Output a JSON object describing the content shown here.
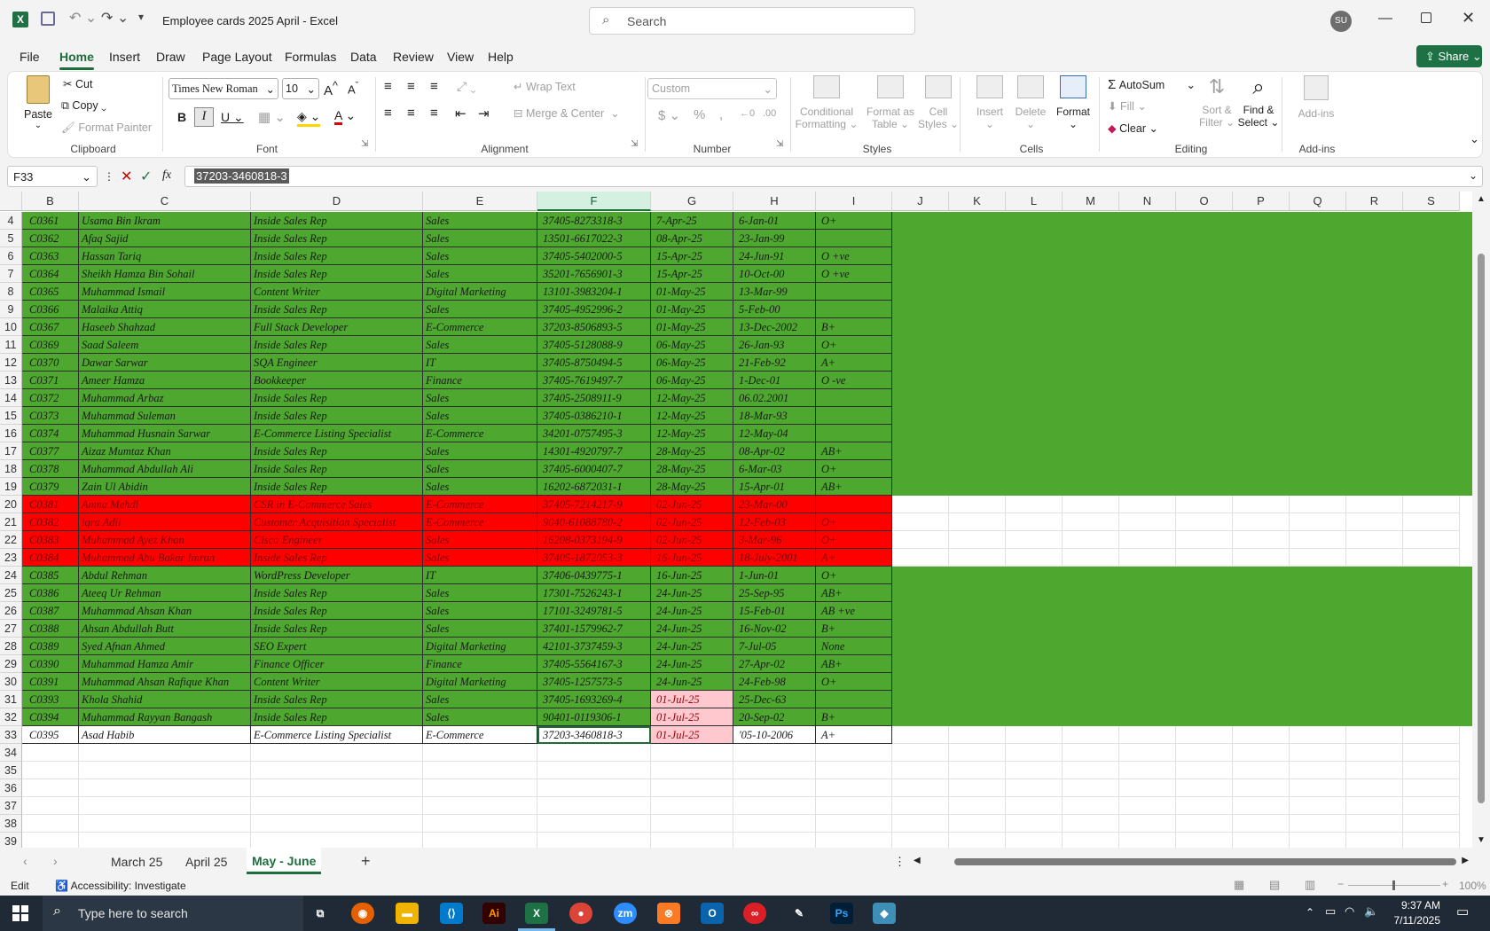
{
  "window": {
    "title": "Employee cards 2025 April  -  Excel",
    "search_placeholder": "Search",
    "user_initials": "SU"
  },
  "menu": {
    "tabs": [
      "File",
      "Home",
      "Insert",
      "Draw",
      "Page Layout",
      "Formulas",
      "Data",
      "Review",
      "View",
      "Help"
    ],
    "share": "Share"
  },
  "ribbon": {
    "clipboard": {
      "label": "Clipboard",
      "paste": "Paste",
      "cut": "Cut",
      "copy": "Copy",
      "format_painter": "Format Painter"
    },
    "font": {
      "label": "Font",
      "family": "Times New Roman",
      "size": "10"
    },
    "alignment": {
      "label": "Alignment",
      "wrap": "Wrap Text",
      "merge": "Merge & Center"
    },
    "number": {
      "label": "Number",
      "format": "Custom"
    },
    "styles": {
      "label": "Styles",
      "conditional": "Conditional",
      "conditional2": "Formatting",
      "format_table": "Format as",
      "format_table2": "Table",
      "cell_styles": "Cell",
      "cell_styles2": "Styles"
    },
    "cells": {
      "label": "Cells",
      "insert": "Insert",
      "delete": "Delete",
      "format": "Format"
    },
    "editing": {
      "label": "Editing",
      "autosum": "AutoSum",
      "fill": "Fill",
      "clear": "Clear",
      "sort": "Sort &",
      "sort2": "Filter",
      "find": "Find &",
      "find2": "Select"
    },
    "addins": {
      "label": "Add-ins",
      "addins": "Add-ins"
    }
  },
  "formula_bar": {
    "name_box": "F33",
    "value": "37203-3460818-3"
  },
  "columns": [
    "B",
    "C",
    "D",
    "E",
    "F",
    "G",
    "H",
    "I",
    "J",
    "K",
    "L",
    "M",
    "N",
    "O",
    "P",
    "Q",
    "R",
    "S"
  ],
  "selected_column": "F",
  "rows": [
    {
      "n": "4",
      "fill": "green",
      "cells": [
        "C0361",
        "Usama Bin Ikram",
        "Inside Sales Rep",
        "Sales",
        "37405-8273318-3",
        "7-Apr-25",
        "6-Jan-01",
        "O+"
      ]
    },
    {
      "n": "5",
      "fill": "green",
      "cells": [
        "C0362",
        "Afaq Sajid",
        "Inside Sales Rep",
        "Sales",
        "13501-6617022-3",
        "08-Apr-25",
        "23-Jan-99",
        ""
      ]
    },
    {
      "n": "6",
      "fill": "green",
      "cells": [
        "C0363",
        "Hassan Tariq",
        "Inside Sales Rep",
        "Sales",
        "37405-5402000-5",
        "15-Apr-25",
        "24-Jun-91",
        "O +ve"
      ]
    },
    {
      "n": "7",
      "fill": "green",
      "cells": [
        "C0364",
        "Sheikh Hamza Bin Sohail",
        "Inside Sales Rep",
        "Sales",
        "35201-7656901-3",
        "15-Apr-25",
        "10-Oct-00",
        "O +ve"
      ]
    },
    {
      "n": "8",
      "fill": "green",
      "cells": [
        "C0365",
        "Muhammad Ismail",
        "Content Writer",
        "Digital Marketing",
        "13101-3983204-1",
        "01-May-25",
        "13-Mar-99",
        ""
      ]
    },
    {
      "n": "9",
      "fill": "green",
      "cells": [
        "C0366",
        "Malaika Attiq",
        "Inside Sales Rep",
        "Sales",
        "37405-4952996-2",
        "01-May-25",
        "5-Feb-00",
        ""
      ]
    },
    {
      "n": "10",
      "fill": "green",
      "cells": [
        "C0367",
        "Haseeb Shahzad",
        "Full Stack Developer",
        "E-Commerce",
        "37203-8506893-5",
        "01-May-25",
        "13-Dec-2002",
        "B+"
      ]
    },
    {
      "n": "11",
      "fill": "green",
      "cells": [
        "C0369",
        "Saad Saleem",
        "Inside Sales Rep",
        "Sales",
        "37405-5128088-9",
        "06-May-25",
        "26-Jan-93",
        "O+"
      ]
    },
    {
      "n": "12",
      "fill": "green",
      "cells": [
        "C0370",
        "Dawar Sarwar",
        "SQA Engineer",
        "IT",
        "37405-8750494-5",
        "06-May-25",
        "21-Feb-92",
        "A+"
      ]
    },
    {
      "n": "13",
      "fill": "green",
      "cells": [
        "C0371",
        "Ameer Hamza",
        "Bookkeeper",
        "Finance",
        "37405-7619497-7",
        "06-May-25",
        "1-Dec-01",
        "O -ve"
      ]
    },
    {
      "n": "14",
      "fill": "green",
      "cells": [
        "C0372",
        "Muhammad Arbaz",
        "Inside Sales Rep",
        "Sales",
        "37405-2508911-9",
        "12-May-25",
        "06.02.2001",
        ""
      ]
    },
    {
      "n": "15",
      "fill": "green",
      "cells": [
        "C0373",
        "Muhammad Suleman",
        "Inside Sales Rep",
        "Sales",
        "37405-0386210-1",
        "12-May-25",
        "18-Mar-93",
        ""
      ]
    },
    {
      "n": "16",
      "fill": "green",
      "cells": [
        "C0374",
        "Muhammad Husnain Sarwar",
        "E-Commerce Listing Specialist",
        "E-Commerce",
        "34201-0757495-3",
        "12-May-25",
        "12-May-04",
        ""
      ]
    },
    {
      "n": "17",
      "fill": "green",
      "cells": [
        "C0377",
        "Aizaz Mumtaz Khan",
        "Inside Sales Rep",
        "Sales",
        "14301-4920797-7",
        "28-May-25",
        "08-Apr-02",
        "AB+"
      ]
    },
    {
      "n": "18",
      "fill": "green",
      "cells": [
        "C0378",
        "Muhammad Abdullah Ali",
        "Inside Sales Rep",
        "Sales",
        "37405-6000407-7",
        "28-May-25",
        "6-Mar-03",
        "O+"
      ]
    },
    {
      "n": "19",
      "fill": "green",
      "cells": [
        "C0379",
        "Zain Ul Abidin",
        "Inside Sales Rep",
        "Sales",
        "16202-6872031-1",
        "28-May-25",
        "15-Apr-01",
        "AB+"
      ]
    },
    {
      "n": "20",
      "fill": "red",
      "cells": [
        "C0381",
        "Amna Mehdi",
        "CSR in E-Commerce Sales",
        "E-Commerce",
        "37405-7214217-9",
        "02-Jun-25",
        "23-Mar-00",
        ""
      ]
    },
    {
      "n": "21",
      "fill": "red",
      "cells": [
        "C0382",
        "iqra Adil",
        "Customer Acquisition Specialist",
        "E-Commerce",
        "9040-61088780-2",
        "02-Jun-25",
        "12-Feb-03",
        "O+"
      ]
    },
    {
      "n": "22",
      "fill": "red",
      "cells": [
        "C0383",
        "Muhammad Ayez Khan",
        "Cisco Engineer",
        "Sales",
        "16208-0373194-9",
        "02-Jun-25",
        "3-Mar-96",
        "O+"
      ]
    },
    {
      "n": "23",
      "fill": "red",
      "cells": [
        "C0384",
        "Muhammad Abu Bakar Imran",
        "Inside Sales Rep",
        "Sales",
        "37405-1872053-3",
        "16-Jun-25",
        "18-July-2001",
        "A+"
      ]
    },
    {
      "n": "24",
      "fill": "green",
      "cells": [
        "C0385",
        "Abdul Rehman",
        "WordPress Developer",
        "IT",
        "37406-0439775-1",
        "16-Jun-25",
        "1-Jun-01",
        "O+"
      ]
    },
    {
      "n": "25",
      "fill": "green",
      "cells": [
        "C0386",
        "Ateeq Ur Rehman",
        "Inside Sales Rep",
        "Sales",
        "17301-7526243-1",
        "24-Jun-25",
        "25-Sep-95",
        "AB+"
      ]
    },
    {
      "n": "26",
      "fill": "green",
      "cells": [
        "C0387",
        "Muhammad Ahsan Khan",
        "Inside Sales Rep",
        "Sales",
        "17101-3249781-5",
        "24-Jun-25",
        "15-Feb-01",
        "AB +ve"
      ]
    },
    {
      "n": "27",
      "fill": "green",
      "cells": [
        "C0388",
        "Ahsan Abdullah Butt",
        "Inside Sales Rep",
        "Sales",
        "37401-1579962-7",
        "24-Jun-25",
        "16-Nov-02",
        "B+"
      ]
    },
    {
      "n": "28",
      "fill": "green",
      "cells": [
        "C0389",
        "Syed Afnan Ahmed",
        "SEO Expert",
        "Digital Marketing",
        "42101-3737459-3",
        "24-Jun-25",
        "7-Jul-05",
        "None"
      ]
    },
    {
      "n": "29",
      "fill": "green",
      "cells": [
        "C0390",
        "Muhammad Hamza Amir",
        "Finance Officer",
        "Finance",
        "37405-5564167-3",
        "24-Jun-25",
        "27-Apr-02",
        "AB+"
      ]
    },
    {
      "n": "30",
      "fill": "green",
      "cells": [
        "C0391",
        "Muhammad Ahsan Rafique Khan",
        "Content Writer",
        "Digital Marketing",
        "37405-1257573-5",
        "24-Jun-25",
        "24-Feb-98",
        "O+"
      ]
    },
    {
      "n": "31",
      "fill": "green",
      "pinkG": true,
      "cells": [
        "C0393",
        "Khola Shahid",
        "Inside Sales Rep",
        "Sales",
        "37405-1693269-4",
        "01-Jul-25",
        "25-Dec-63",
        ""
      ]
    },
    {
      "n": "32",
      "fill": "green",
      "pinkG": true,
      "cells": [
        "C0394",
        "Muhammad Rayyan Bangash",
        "Inside Sales Rep",
        "Sales",
        "90401-0119306-1",
        "01-Jul-25",
        "20-Sep-02",
        "B+"
      ]
    },
    {
      "n": "33",
      "fill": "white",
      "pinkG": true,
      "cells": [
        "C0395",
        "Asad Habib",
        "E-Commerce Listing Specialist",
        "E-Commerce",
        "37203-3460818-3",
        "01-Jul-25",
        "'05-10-2006",
        "A+"
      ]
    }
  ],
  "empty_rows": [
    "34",
    "35",
    "36",
    "37",
    "38",
    "39"
  ],
  "sheets": {
    "tabs": [
      "March 25",
      "April 25",
      "May - June"
    ],
    "active": "May - June"
  },
  "status": {
    "mode": "Edit",
    "accessibility": "Accessibility: Investigate",
    "zoom": "100%"
  },
  "taskbar": {
    "search_placeholder": "Type here to search",
    "time": "9:37 AM",
    "date": "7/11/2025"
  },
  "colors": {
    "green": "#4ea72e",
    "red": "#ff0000",
    "pink": "#ffc7ce",
    "accent": "#1e6e3c"
  }
}
